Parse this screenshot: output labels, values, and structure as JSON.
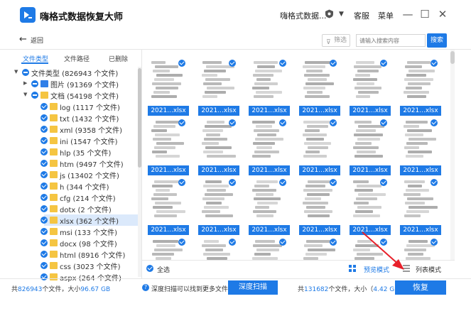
{
  "app": {
    "title": "嗨格式数据恢复大师",
    "account_name": "嗨格式数据...",
    "service_label": "客服",
    "menu_label": "菜单",
    "minimize_symbol": "—",
    "maximize_symbol": "☐",
    "close_symbol": "✕"
  },
  "toolbar": {
    "back_label": "返回",
    "back_symbol": "←",
    "filter_label": "筛选",
    "search_placeholder": "请输入搜索内容",
    "search_button": "搜索"
  },
  "sidebar": {
    "tabs": [
      "文件类型",
      "文件路径",
      "已删除"
    ],
    "active_tab_index": 0,
    "tree": [
      {
        "label": "文件类型 (826943 个文件)",
        "level": 0,
        "expand": "open",
        "check": "partial",
        "folder": "none"
      },
      {
        "label": "图片 (91369 个文件)",
        "level": 1,
        "expand": "closed",
        "check": "partial",
        "folder": "blue"
      },
      {
        "label": "文档 (54198 个文件)",
        "level": 1,
        "expand": "open",
        "check": "partial",
        "folder": "yellow"
      },
      {
        "label": "log (1117 个文件)",
        "level": 2,
        "expand": "none",
        "check": "full",
        "folder": "yellow"
      },
      {
        "label": "txt (1432 个文件)",
        "level": 2,
        "expand": "none",
        "check": "full",
        "folder": "yellow"
      },
      {
        "label": "xml (9358 个文件)",
        "level": 2,
        "expand": "none",
        "check": "full",
        "folder": "yellow"
      },
      {
        "label": "ini (1547 个文件)",
        "level": 2,
        "expand": "none",
        "check": "full",
        "folder": "yellow"
      },
      {
        "label": "hlp (35 个文件)",
        "level": 2,
        "expand": "none",
        "check": "full",
        "folder": "yellow"
      },
      {
        "label": "htm (9497 个文件)",
        "level": 2,
        "expand": "none",
        "check": "full",
        "folder": "yellow"
      },
      {
        "label": "js (13402 个文件)",
        "level": 2,
        "expand": "none",
        "check": "full",
        "folder": "yellow"
      },
      {
        "label": "h (344 个文件)",
        "level": 2,
        "expand": "none",
        "check": "full",
        "folder": "yellow"
      },
      {
        "label": "cfg (214 个文件)",
        "level": 2,
        "expand": "none",
        "check": "full",
        "folder": "yellow"
      },
      {
        "label": "dotx (2 个文件)",
        "level": 2,
        "expand": "none",
        "check": "full",
        "folder": "yellow"
      },
      {
        "label": "xlsx (362 个文件)",
        "level": 2,
        "expand": "none",
        "check": "full",
        "folder": "yellow",
        "selected": true
      },
      {
        "label": "msi (133 个文件)",
        "level": 2,
        "expand": "none",
        "check": "full",
        "folder": "yellow"
      },
      {
        "label": "docx (98 个文件)",
        "level": 2,
        "expand": "none",
        "check": "full",
        "folder": "yellow"
      },
      {
        "label": "html (8916 个文件)",
        "level": 2,
        "expand": "none",
        "check": "full",
        "folder": "yellow"
      },
      {
        "label": "css (3023 个文件)",
        "level": 2,
        "expand": "none",
        "check": "full",
        "folder": "yellow"
      },
      {
        "label": "aspx (264 个文件)",
        "level": 2,
        "expand": "none",
        "check": "full",
        "folder": "yellow"
      }
    ]
  },
  "grid": {
    "file_label": "2021...xlsx",
    "columns": 6,
    "full_rows": 3,
    "partial_row_count": 6
  },
  "selectbar": {
    "select_all_label": "全选",
    "preview_mode_label": "预览模式",
    "list_mode_label": "列表模式"
  },
  "status": {
    "total_prefix": "共",
    "total_count": "826943",
    "total_mid": "个文件，大小",
    "total_size": "96.67 GB",
    "deep_hint": "深度扫描可以找到更多文件",
    "deep_scan_button": "深度扫描",
    "sel_prefix": "共",
    "sel_count": "131682",
    "sel_mid": "个文件，大小（",
    "sel_size": "4.42 GB",
    "sel_suffix": "）",
    "recover_button": "恢复"
  },
  "colors": {
    "accent": "#1e7ae6",
    "folder_yellow": "#f5c542",
    "annotation_arrow": "#e8202a"
  }
}
